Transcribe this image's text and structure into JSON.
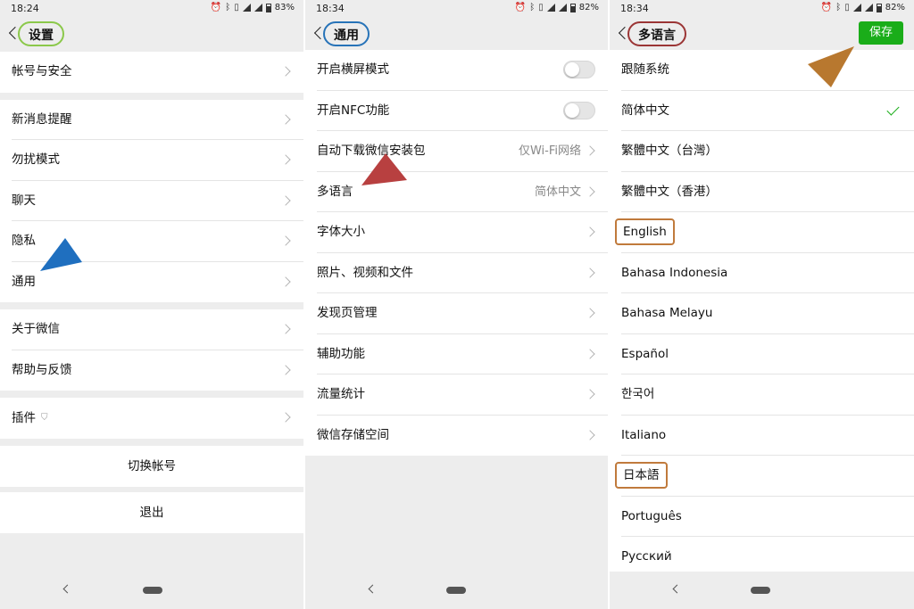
{
  "colors": {
    "accent": "#1aad19",
    "circle_settings": "#8bc84a",
    "circle_general": "#2773b8",
    "circle_language": "#9b3535",
    "box": "#c07a3c"
  },
  "panels": [
    {
      "status": {
        "time": "18:24",
        "battery": "83%"
      },
      "title": "设置",
      "groups": [
        [
          "帐号与安全"
        ],
        [
          "新消息提醒",
          "勿扰模式",
          "聊天",
          "隐私",
          "通用"
        ],
        [
          "关于微信",
          "帮助与反馈"
        ],
        [
          "插件"
        ]
      ],
      "switch_account": "切换帐号",
      "logout": "退出"
    },
    {
      "status": {
        "time": "18:34",
        "battery": "82%"
      },
      "title": "通用",
      "items": [
        {
          "label": "开启横屏模式"
        },
        {
          "label": "开启NFC功能"
        },
        {
          "label": "自动下载微信安装包",
          "value": "仅Wi-Fi网络"
        },
        {
          "label": "多语言",
          "value": "简体中文"
        },
        {
          "label": "字体大小"
        },
        {
          "label": "照片、视频和文件"
        },
        {
          "label": "发现页管理"
        },
        {
          "label": "辅助功能"
        },
        {
          "label": "流量统计"
        },
        {
          "label": "微信存储空间"
        }
      ]
    },
    {
      "status": {
        "time": "18:34",
        "battery": "82%"
      },
      "title": "多语言",
      "save": "保存",
      "languages": [
        "跟随系统",
        "简体中文",
        "繁體中文（台灣）",
        "繁體中文（香港）",
        "English",
        "Bahasa Indonesia",
        "Bahasa Melayu",
        "Español",
        "한국어",
        "Italiano",
        "日本語",
        "Português",
        "Русский"
      ],
      "selected": "简体中文"
    }
  ],
  "icons": [
    "back-icon",
    "chevron-right-icon",
    "checkmark-icon",
    "alarm-icon",
    "bluetooth-icon",
    "vibrate-icon",
    "signal-icon",
    "battery-icon",
    "plugin-shield-icon"
  ]
}
